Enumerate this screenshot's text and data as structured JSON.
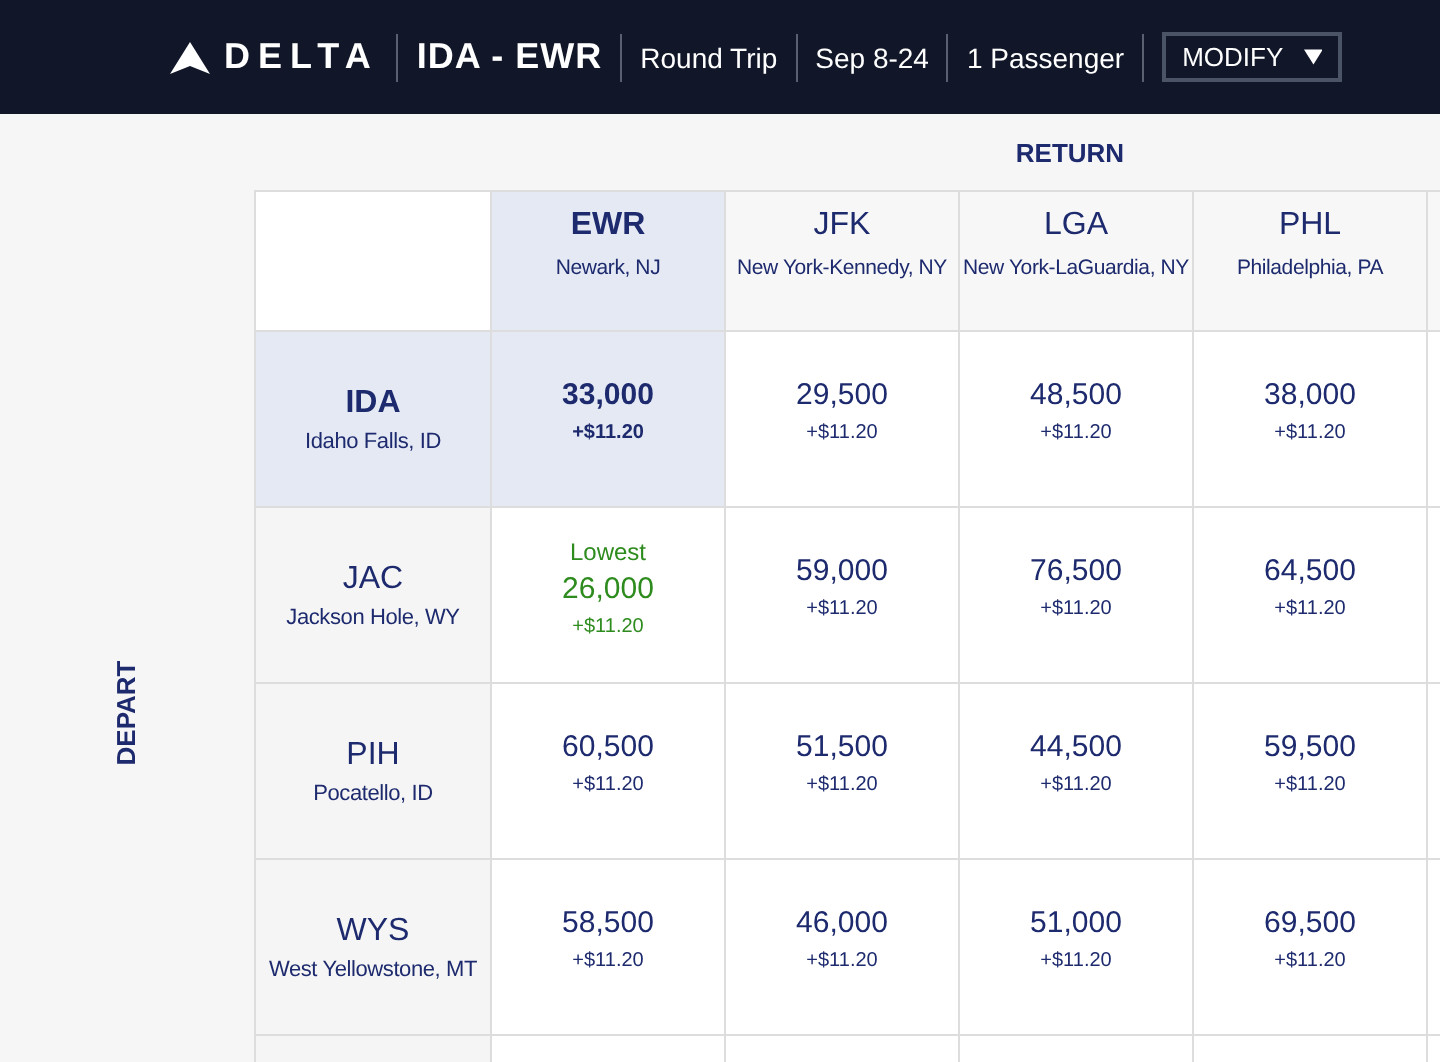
{
  "header": {
    "logo": "DELTA",
    "route": "IDA - EWR",
    "trip_type": "Round Trip",
    "dates": "Sep 8-24",
    "passengers": "1 Passenger",
    "modify_button": "MODIFY"
  },
  "return_label": "RETURN",
  "depart_label": "DEPART",
  "columns": [
    {
      "code": "EWR",
      "city": "Newark, NJ",
      "selected": true
    },
    {
      "code": "JFK",
      "city": "New York-Kennedy, NY",
      "selected": false
    },
    {
      "code": "LGA",
      "city": "New York-LaGuardia, NY",
      "selected": false
    },
    {
      "code": "PHL",
      "city": "Philadelphia, PA",
      "selected": false
    }
  ],
  "rows": [
    {
      "code": "IDA",
      "city": "Idaho Falls, ID",
      "selected": true,
      "fares": [
        {
          "miles": "33,000",
          "fee": "+$11.20",
          "lowest": false
        },
        {
          "miles": "29,500",
          "fee": "+$11.20",
          "lowest": false
        },
        {
          "miles": "48,500",
          "fee": "+$11.20",
          "lowest": false
        },
        {
          "miles": "38,000",
          "fee": "+$11.20",
          "lowest": false
        }
      ]
    },
    {
      "code": "JAC",
      "city": "Jackson Hole, WY",
      "selected": false,
      "fares": [
        {
          "miles": "26,000",
          "fee": "+$11.20",
          "lowest": true,
          "label": "Lowest"
        },
        {
          "miles": "59,000",
          "fee": "+$11.20",
          "lowest": false
        },
        {
          "miles": "76,500",
          "fee": "+$11.20",
          "lowest": false
        },
        {
          "miles": "64,500",
          "fee": "+$11.20",
          "lowest": false
        }
      ]
    },
    {
      "code": "PIH",
      "city": "Pocatello, ID",
      "selected": false,
      "fares": [
        {
          "miles": "60,500",
          "fee": "+$11.20",
          "lowest": false
        },
        {
          "miles": "51,500",
          "fee": "+$11.20",
          "lowest": false
        },
        {
          "miles": "44,500",
          "fee": "+$11.20",
          "lowest": false
        },
        {
          "miles": "59,500",
          "fee": "+$11.20",
          "lowest": false
        }
      ]
    },
    {
      "code": "WYS",
      "city": "West Yellowstone, MT",
      "selected": false,
      "fares": [
        {
          "miles": "58,500",
          "fee": "+$11.20",
          "lowest": false
        },
        {
          "miles": "46,000",
          "fee": "+$11.20",
          "lowest": false
        },
        {
          "miles": "51,000",
          "fee": "+$11.20",
          "lowest": false
        },
        {
          "miles": "69,500",
          "fee": "+$11.20",
          "lowest": false
        }
      ]
    }
  ]
}
